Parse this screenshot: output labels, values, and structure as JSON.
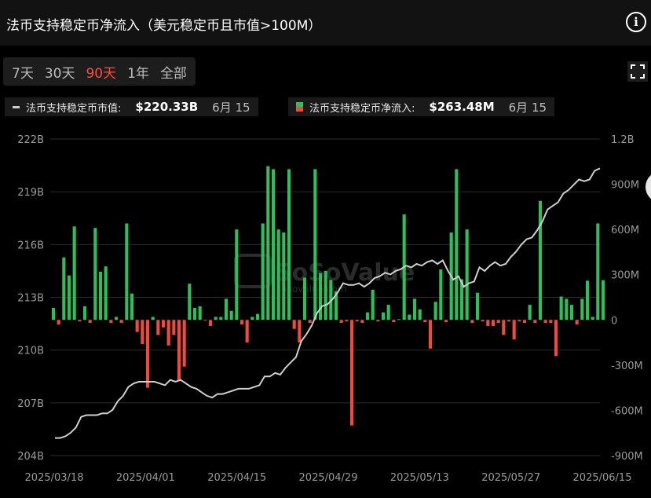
{
  "header": {
    "title": "法币支持稳定币净流入（美元稳定币且市值>100M）"
  },
  "ranges": [
    {
      "label": "7天",
      "active": false
    },
    {
      "label": "30天",
      "active": false
    },
    {
      "label": "90天",
      "active": true
    },
    {
      "label": "1年",
      "active": false
    },
    {
      "label": "全部",
      "active": false
    }
  ],
  "legend": {
    "marketcap": {
      "label": "法币支持稳定币市值:",
      "value": "$220.33B",
      "date": "6月 15"
    },
    "inflow": {
      "label": "法币支持稳定币净流入:",
      "value": "$263.48M",
      "date": "6月 15"
    }
  },
  "watermark": {
    "brand": "SoSoValue",
    "sub": "sosovalue.com"
  },
  "chart_data": {
    "type": "bar+line",
    "x_tick_labels": [
      "2025/03/18",
      "2025/04/01",
      "2025/04/15",
      "2025/04/29",
      "2025/05/13",
      "2025/05/27",
      "2025/06/15"
    ],
    "left_axis": {
      "ticks": [
        "222B",
        "219B",
        "216B",
        "213B",
        "210B",
        "207B",
        "204B"
      ],
      "range": [
        204,
        222
      ],
      "unit": "B"
    },
    "right_axis": {
      "ticks": [
        "1.2B",
        "900M",
        "600M",
        "300M",
        "0",
        "-300M",
        "-600M",
        "-900M"
      ],
      "range": [
        -900,
        1200
      ],
      "unit": "M"
    },
    "colors": {
      "positive": "#2fbf5a",
      "negative": "#ef4a3c",
      "line": "#cfcfcf"
    },
    "series": [
      {
        "name": "法币支持稳定币净流入",
        "axis": "right",
        "values": [
          80,
          -30,
          415,
          295,
          620,
          -10,
          90,
          -20,
          610,
          320,
          355,
          -20,
          20,
          -20,
          640,
          175,
          -80,
          -160,
          -450,
          20,
          -100,
          -50,
          -170,
          -100,
          -400,
          -310,
          240,
          80,
          90,
          -5,
          -40,
          20,
          20,
          140,
          60,
          600,
          -30,
          -150,
          20,
          40,
          640,
          1020,
          1000,
          600,
          580,
          1000,
          -60,
          -150,
          280,
          -20,
          1000,
          310,
          325,
          265,
          190,
          -20,
          -10,
          -700,
          -10,
          -20,
          50,
          200,
          -10,
          50,
          100,
          -15,
          5,
          700,
          35,
          140,
          70,
          -15,
          -190,
          120,
          335,
          -15,
          580,
          1000,
          270,
          600,
          -20,
          180,
          -10,
          -40,
          -40,
          -20,
          -100,
          -10,
          -130,
          -10,
          -20,
          100,
          -20,
          790,
          -20,
          -20,
          -240,
          155,
          140,
          100,
          -30,
          140,
          260,
          20,
          640,
          263.48
        ]
      },
      {
        "name": "法币支持稳定币市值",
        "axis": "left",
        "values": [
          205.0,
          205.0,
          205.1,
          205.3,
          205.6,
          206.2,
          206.3,
          206.3,
          206.3,
          206.4,
          206.4,
          206.6,
          207.1,
          207.4,
          207.9,
          208.1,
          208.2,
          208.2,
          208.2,
          208.2,
          208.1,
          208.0,
          208.3,
          208.2,
          208.3,
          208.1,
          207.9,
          207.8,
          207.6,
          207.4,
          207.3,
          207.5,
          207.5,
          207.6,
          207.7,
          207.8,
          207.8,
          207.8,
          207.9,
          208.0,
          208.5,
          208.5,
          208.7,
          208.6,
          209.0,
          209.3,
          209.6,
          210.5,
          210.9,
          211.4,
          212.1,
          212.5,
          212.6,
          212.9,
          213.3,
          213.8,
          213.7,
          213.7,
          213.8,
          213.6,
          213.8,
          214.1,
          214.2,
          214.4,
          214.3,
          214.5,
          214.6,
          214.8,
          214.7,
          214.9,
          214.8,
          215.0,
          215.1,
          214.9,
          215.1,
          214.5,
          214.0,
          214.2,
          213.6,
          213.8,
          213.9,
          214.7,
          214.5,
          214.8,
          215.0,
          214.8,
          214.9,
          215.3,
          215.6,
          216.0,
          216.3,
          216.4,
          216.8,
          217.3,
          218.0,
          218.2,
          218.4,
          218.9,
          219.1,
          219.4,
          219.7,
          219.6,
          219.7,
          220.2,
          220.33
        ]
      }
    ]
  }
}
